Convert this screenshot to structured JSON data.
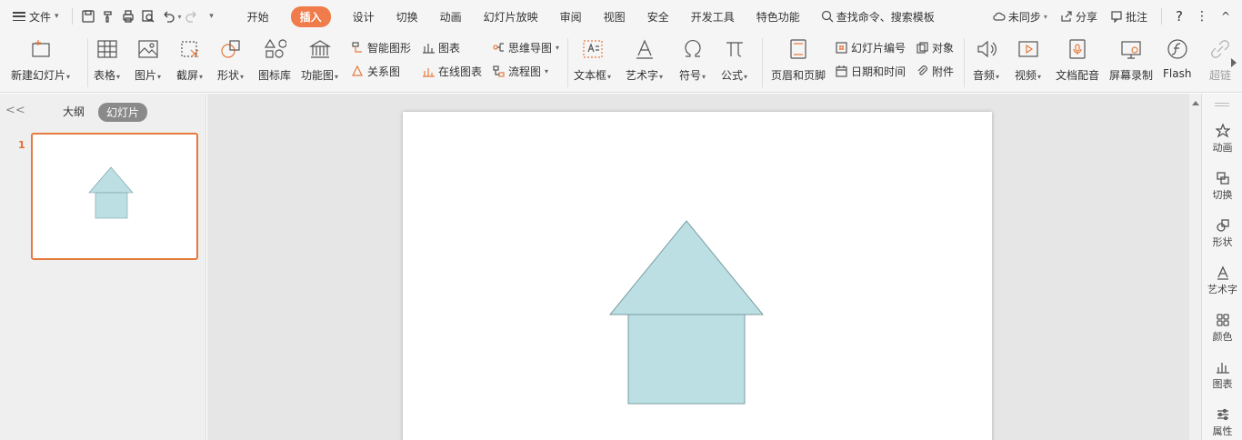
{
  "menu": {
    "file_label": "文件",
    "tabs": [
      {
        "label": "开始"
      },
      {
        "label": "插入",
        "active": true
      },
      {
        "label": "设计"
      },
      {
        "label": "切换"
      },
      {
        "label": "动画"
      },
      {
        "label": "幻灯片放映"
      },
      {
        "label": "审阅"
      },
      {
        "label": "视图"
      },
      {
        "label": "安全"
      },
      {
        "label": "开发工具"
      },
      {
        "label": "特色功能"
      }
    ],
    "search_label": "查找命令、搜索模板",
    "sync_label": "未同步",
    "share_label": "分享",
    "comment_label": "批注",
    "help_label": "?",
    "more_label": "⋮",
    "collapse_label": "^"
  },
  "ribbon": {
    "new_slide": "新建幻灯片",
    "table": "表格",
    "picture": "图片",
    "screenshot": "截屏",
    "shape": "形状",
    "icon_lib": "图标库",
    "function_chart": "功能图",
    "smart_art": "智能图形",
    "chart": "图表",
    "relation": "关系图",
    "online_chart": "在线图表",
    "mindmap": "思维导图",
    "flowchart": "流程图",
    "textbox": "文本框",
    "wordart": "艺术字",
    "symbol": "符号",
    "formula": "公式",
    "header_footer": "页眉和页脚",
    "slide_number": "幻灯片编号",
    "object": "对象",
    "datetime": "日期和时间",
    "attachment": "附件",
    "audio": "音频",
    "video": "视频",
    "narration": "文档配音",
    "screen_record": "屏幕录制",
    "flash": "Flash",
    "hyperlink": "超链"
  },
  "left_panel": {
    "outline_tab": "大纲",
    "slides_tab": "幻灯片",
    "slide_number": "1",
    "collapse": "<<"
  },
  "right_bar": {
    "animation": "动画",
    "transition": "切换",
    "shape": "形状",
    "wordart": "艺术字",
    "color": "颜色",
    "chart": "图表",
    "properties": "属性"
  },
  "colors": {
    "accent": "#ef7c4a",
    "shape_fill": "#bcdfe3",
    "shape_stroke": "#7a9ea2"
  }
}
